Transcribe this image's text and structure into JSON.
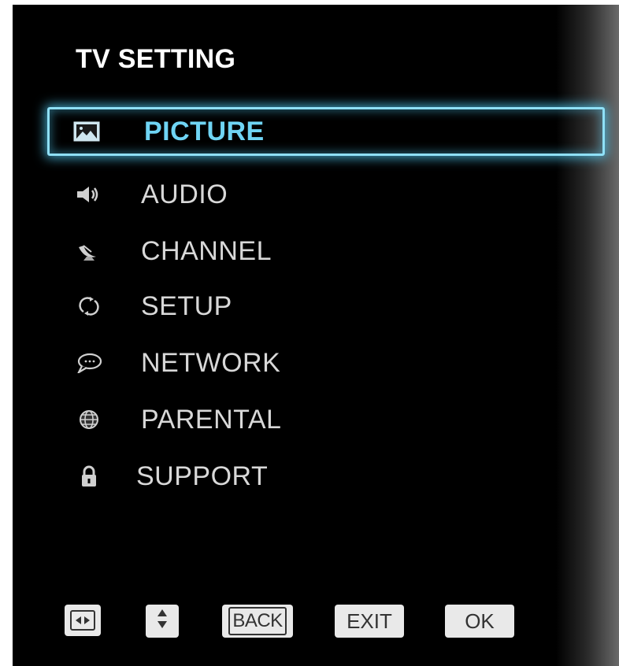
{
  "header": {
    "title": "TV SETTING"
  },
  "menu": {
    "items": [
      {
        "label": "PICTURE",
        "icon": "picture-icon",
        "selected": true
      },
      {
        "label": "AUDIO",
        "icon": "speaker-icon",
        "selected": false
      },
      {
        "label": "CHANNEL",
        "icon": "satellite-dish-icon",
        "selected": false
      },
      {
        "label": "SETUP",
        "icon": "refresh-icon",
        "selected": false
      },
      {
        "label": "NETWORK",
        "icon": "speech-bubble-icon",
        "selected": false
      },
      {
        "label": "PARENTAL",
        "icon": "globe-icon",
        "selected": false
      },
      {
        "label": "SUPPORT",
        "icon": "lock-icon",
        "selected": false
      }
    ]
  },
  "footer": {
    "keys": [
      {
        "name": "left-right-key",
        "icon": "left-right-arrows-icon"
      },
      {
        "name": "up-down-key",
        "icon": "up-down-arrows-icon"
      },
      {
        "name": "back-key",
        "label": "BACK"
      },
      {
        "name": "exit-key",
        "label": "EXIT"
      },
      {
        "name": "ok-key",
        "label": "OK"
      }
    ]
  },
  "colors": {
    "background": "#000000",
    "highlight": "#6fd4f4",
    "text": "#d8d8d8",
    "key_background": "#e9e9e9"
  }
}
